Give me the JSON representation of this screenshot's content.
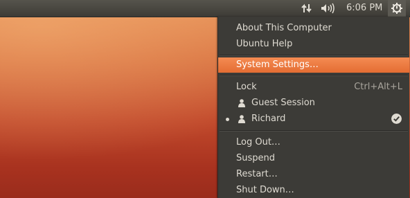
{
  "panel": {
    "clock": "6:06 PM",
    "network_icon": "network-transfer-icon",
    "volume_icon": "volume-icon",
    "session_icon": "gear-power-icon",
    "annotation_color": "#e8262a"
  },
  "menu": {
    "about": "About This Computer",
    "help": "Ubuntu Help",
    "settings": "System Settings…",
    "lock": "Lock",
    "lock_shortcut": "Ctrl+Alt+L",
    "guest": "Guest Session",
    "user": "Richard",
    "logout": "Log Out…",
    "suspend": "Suspend",
    "restart": "Restart…",
    "shutdown": "Shut Down…",
    "highlight_color": "#f07746"
  }
}
